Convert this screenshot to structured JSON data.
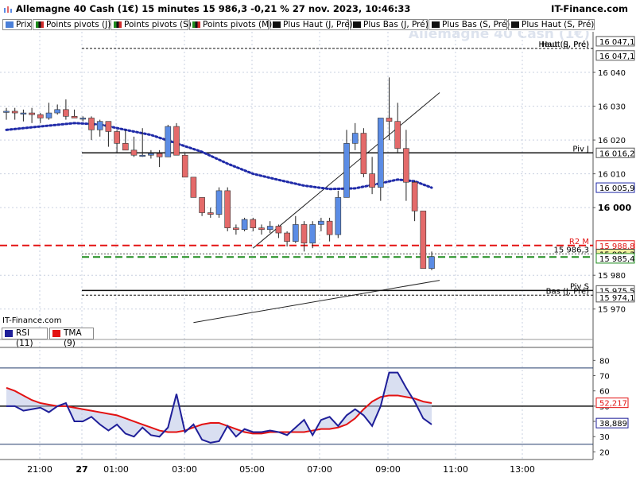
{
  "header": {
    "title": "Allemagne 40 Cash (1€) 15 minutes 15 986,3 -0,21 % 27 nov. 2023, 10:46:33",
    "site": "IT-Finance.com",
    "brand": "IT-Finance.com"
  },
  "legend": [
    {
      "label": "Prix",
      "color": "#4a7fd8"
    },
    {
      "label": "Points pivots (J)",
      "color": "#d02a2a"
    },
    {
      "label": "Points pivots (S)",
      "color": "#d02a2a"
    },
    {
      "label": "Points pivots (M)",
      "color": "#d02a2a"
    },
    {
      "label": "Plus Haut (J, Pré)",
      "color": "#111111"
    },
    {
      "label": "Plus Bas (J, Pré)",
      "color": "#111111"
    },
    {
      "label": "Plus Bas (S, Pré)",
      "color": "#111111"
    },
    {
      "label": "Plus Haut (S, Pré)",
      "color": "#111111"
    }
  ],
  "rsi_legend": {
    "rsi": "RSI (11)",
    "tma": "TMA (9)",
    "rsi_color": "#1f1f99",
    "tma_color": "#e31212"
  },
  "colors": {
    "up": "#5b8ce5",
    "down": "#e46a6a",
    "pivot_red": "#e31212",
    "pivot_green": "#1e8c1e",
    "ma": "#1f2aa8"
  },
  "chart_data": {
    "type": "candlestick",
    "watermark": "Allemagne 40 Cash (1€)",
    "price_ylim": [
      15965,
      16052
    ],
    "price_ticks": [
      {
        "value": 15970,
        "label": "15 970"
      },
      {
        "value": 15980,
        "label": "15 980"
      },
      {
        "value": 16000,
        "label": "16 000"
      },
      {
        "value": 16010,
        "label": "16 010"
      },
      {
        "value": 16020,
        "label": "16 020"
      },
      {
        "value": 16030,
        "label": "16 030"
      },
      {
        "value": 16040,
        "label": "16 040"
      }
    ],
    "time_ticks": [
      "21:00",
      "27",
      "01:00",
      "03:00",
      "05:00",
      "07:00",
      "09:00",
      "11:00",
      "13:00"
    ],
    "candles": [
      {
        "o": 16028.5,
        "h": 16029.5,
        "l": 16026,
        "c": 16028.5
      },
      {
        "o": 16028.5,
        "h": 16029.5,
        "l": 16026,
        "c": 16028
      },
      {
        "o": 16028,
        "h": 16029,
        "l": 16025.5,
        "c": 16028
      },
      {
        "o": 16028,
        "h": 16029.5,
        "l": 16025,
        "c": 16027.5
      },
      {
        "o": 16027.5,
        "h": 16028,
        "l": 16025,
        "c": 16026.5
      },
      {
        "o": 16026.5,
        "h": 16031,
        "l": 16026,
        "c": 16028
      },
      {
        "o": 16028,
        "h": 16030.5,
        "l": 16027.5,
        "c": 16029
      },
      {
        "o": 16029,
        "h": 16032,
        "l": 16026,
        "c": 16027
      },
      {
        "o": 16027,
        "h": 16029,
        "l": 16026.5,
        "c": 16026.5
      },
      {
        "o": 16026.5,
        "h": 16027,
        "l": 16025.5,
        "c": 16026.5
      },
      {
        "o": 16026.5,
        "h": 16027,
        "l": 16020,
        "c": 16023
      },
      {
        "o": 16023,
        "h": 16026,
        "l": 16021,
        "c": 16025.5
      },
      {
        "o": 16025.5,
        "h": 16025.5,
        "l": 16018,
        "c": 16022.5
      },
      {
        "o": 16022.5,
        "h": 16023,
        "l": 16016,
        "c": 16019
      },
      {
        "o": 16019,
        "h": 16023,
        "l": 16017,
        "c": 16017
      },
      {
        "o": 16017,
        "h": 16021,
        "l": 16015,
        "c": 16015.5
      },
      {
        "o": 16015.5,
        "h": 16023.5,
        "l": 16015,
        "c": 16015.5
      },
      {
        "o": 16015.5,
        "h": 16017,
        "l": 16014.5,
        "c": 16016
      },
      {
        "o": 16016,
        "h": 16017,
        "l": 16012,
        "c": 16015
      },
      {
        "o": 16015,
        "h": 16024.5,
        "l": 16015,
        "c": 16024
      },
      {
        "o": 16024,
        "h": 16025,
        "l": 16015.5,
        "c": 16015.5
      },
      {
        "o": 16015.5,
        "h": 16016,
        "l": 16010,
        "c": 16009
      },
      {
        "o": 16009,
        "h": 16009,
        "l": 16003,
        "c": 16003
      },
      {
        "o": 16003,
        "h": 16003,
        "l": 15997.5,
        "c": 15998.5
      },
      {
        "o": 15998.5,
        "h": 16000,
        "l": 15997,
        "c": 15998
      },
      {
        "o": 15998,
        "h": 16006,
        "l": 15997,
        "c": 16005
      },
      {
        "o": 16005,
        "h": 16006,
        "l": 15993,
        "c": 15994
      },
      {
        "o": 15994,
        "h": 15995,
        "l": 15992,
        "c": 15993.5
      },
      {
        "o": 15993.5,
        "h": 15997,
        "l": 15993,
        "c": 15996.5
      },
      {
        "o": 15996.5,
        "h": 15997,
        "l": 15993,
        "c": 15994
      },
      {
        "o": 15994,
        "h": 15995,
        "l": 15992,
        "c": 15993.5
      },
      {
        "o": 15993.5,
        "h": 15996,
        "l": 15992.5,
        "c": 15994.5
      },
      {
        "o": 15994.5,
        "h": 15995,
        "l": 15991,
        "c": 15992.5
      },
      {
        "o": 15992.5,
        "h": 15993,
        "l": 15988.5,
        "c": 15990
      },
      {
        "o": 15990,
        "h": 15997.5,
        "l": 15989.5,
        "c": 15995
      },
      {
        "o": 15995,
        "h": 15996,
        "l": 15987,
        "c": 15989.5
      },
      {
        "o": 15989.5,
        "h": 15996,
        "l": 15988,
        "c": 15995
      },
      {
        "o": 15995,
        "h": 15997,
        "l": 15993,
        "c": 15996
      },
      {
        "o": 15996,
        "h": 15997,
        "l": 15990,
        "c": 15992
      },
      {
        "o": 15992,
        "h": 16005,
        "l": 15991,
        "c": 16003
      },
      {
        "o": 16003,
        "h": 16023,
        "l": 16003,
        "c": 16019
      },
      {
        "o": 16019,
        "h": 16025,
        "l": 16017,
        "c": 16022
      },
      {
        "o": 16022,
        "h": 16023.5,
        "l": 16009,
        "c": 16010
      },
      {
        "o": 16010,
        "h": 16015,
        "l": 16004,
        "c": 16006
      },
      {
        "o": 16006,
        "h": 16022,
        "l": 16002,
        "c": 16026.5
      },
      {
        "o": 16026.5,
        "h": 16038.5,
        "l": 16020,
        "c": 16025.5
      },
      {
        "o": 16025.5,
        "h": 16031,
        "l": 16016,
        "c": 16017.5
      },
      {
        "o": 16017.5,
        "h": 16023,
        "l": 16002,
        "c": 16007.5
      },
      {
        "o": 16007.5,
        "h": 16008,
        "l": 15996,
        "c": 15999
      },
      {
        "o": 15999,
        "h": 15998.5,
        "l": 15984,
        "c": 15982
      },
      {
        "o": 15982,
        "h": 15987,
        "l": 15981.5,
        "c": 15985.5
      }
    ],
    "levels": [
      {
        "name": "Haut (S, Pré)",
        "value": 16047.1,
        "label": "16 047,1",
        "style": "dash-black"
      },
      {
        "name": "Haut (J, Pré)",
        "value": 16047.1,
        "label": "16 047,1",
        "style": "none"
      },
      {
        "name": "Piv J",
        "value": 16016.2,
        "label": "16 016,2",
        "style": "solid-black"
      },
      {
        "name": "R2 M",
        "value": 15988.8,
        "label": "15 988,8",
        "style": "dash-red"
      },
      {
        "name": "",
        "value": 15986.3,
        "label": "15 986,3",
        "style": "dash-gray"
      },
      {
        "name": "",
        "value": 15985.4,
        "label": "15 985,4",
        "style": "dash-green"
      },
      {
        "name": "Piv S",
        "value": 15975.5,
        "label": "15 975,5",
        "style": "solid-black"
      },
      {
        "name": "Bas (J, Pré)",
        "value": 15974.1,
        "label": "15 974,1",
        "style": "dash-black"
      }
    ],
    "current_price": {
      "value": 15986.3,
      "label": "15 986,3"
    },
    "ma_value": {
      "value": 16005.9,
      "label": "16 005,9"
    },
    "overlay_labels": [
      "Haut (S, Pré)",
      "Haut (J, Pré)",
      "Piv J",
      "R2 M",
      "15 986,3",
      "Piv S",
      "Bas (J, Pré)"
    ],
    "ma": [
      {
        "i": 0,
        "v": 16023
      },
      {
        "i": 4,
        "v": 16024
      },
      {
        "i": 8,
        "v": 16025
      },
      {
        "i": 11,
        "v": 16024.6
      },
      {
        "i": 14,
        "v": 16023
      },
      {
        "i": 17,
        "v": 16021.5
      },
      {
        "i": 20,
        "v": 16019
      },
      {
        "i": 23,
        "v": 16016.5
      },
      {
        "i": 26,
        "v": 16013
      },
      {
        "i": 29,
        "v": 16010
      },
      {
        "i": 32,
        "v": 16008.2
      },
      {
        "i": 35,
        "v": 16006.5
      },
      {
        "i": 38,
        "v": 16005.5
      },
      {
        "i": 41,
        "v": 16005.7
      },
      {
        "i": 44,
        "v": 16007.2
      },
      {
        "i": 46,
        "v": 16008.3
      },
      {
        "i": 48,
        "v": 16007.8
      },
      {
        "i": 50,
        "v": 16005.9
      }
    ],
    "trendlines": [
      {
        "from": {
          "i": 29,
          "v": 15988
        },
        "to": {
          "i": 50,
          "v": 16034
        }
      },
      {
        "from": {
          "i": 22,
          "v": 15966
        },
        "to": {
          "i": 50,
          "v": 15978.5
        }
      }
    ],
    "rsi": {
      "ylim": [
        15,
        88
      ],
      "ticks": [
        20,
        30,
        40,
        50,
        60,
        70,
        80
      ],
      "levels": [
        75,
        50,
        25
      ],
      "value_label": "38,889",
      "tma_label": "52,217",
      "rsi_values": [
        50,
        50,
        47,
        48,
        49,
        46,
        50,
        52,
        40,
        40,
        43,
        38,
        34,
        38,
        32,
        30,
        36,
        31,
        30,
        36,
        58,
        33,
        38,
        28,
        26,
        27,
        37,
        30,
        35,
        33,
        33,
        34,
        33,
        31,
        36,
        41,
        31,
        41,
        43,
        37,
        44,
        48,
        44,
        37,
        50,
        72,
        72,
        62,
        53,
        42,
        38
      ],
      "tma_values": [
        62,
        60,
        57,
        54,
        52,
        51,
        50,
        50,
        49,
        48,
        47,
        46,
        45,
        44,
        42,
        40,
        38,
        36,
        34,
        33,
        33,
        34,
        36,
        38,
        39,
        39,
        37,
        35,
        33,
        32,
        32,
        33,
        33,
        33,
        33,
        33,
        34,
        35,
        35,
        36,
        38,
        42,
        48,
        53,
        56,
        57,
        57,
        56,
        55,
        53,
        52
      ]
    }
  }
}
